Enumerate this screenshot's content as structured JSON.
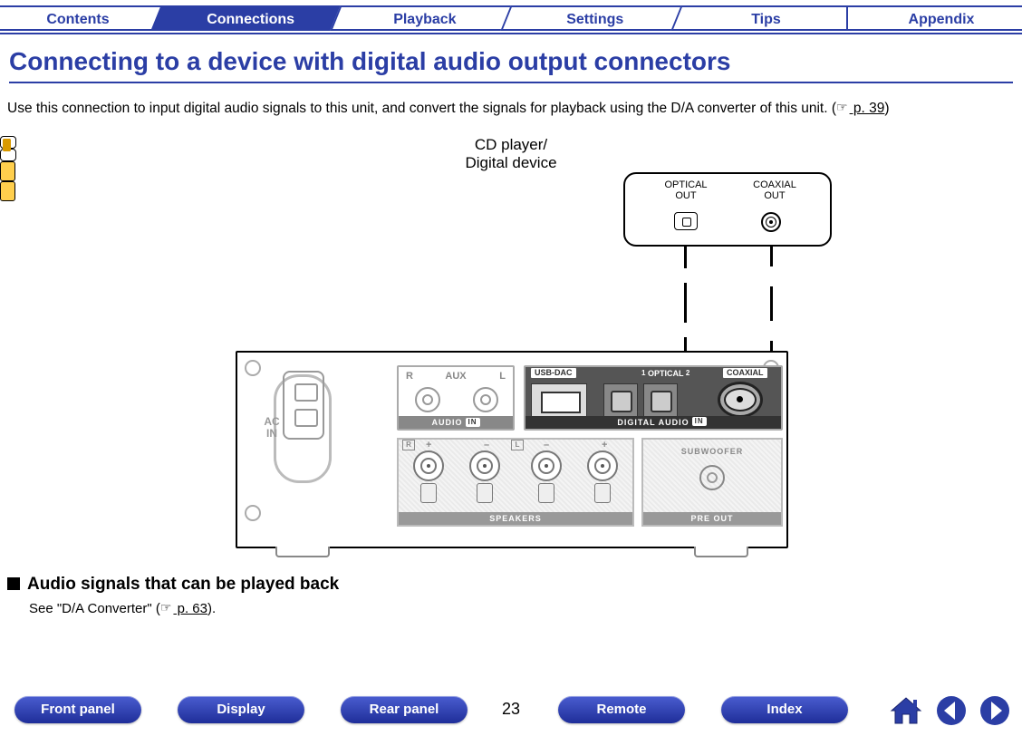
{
  "tabs": {
    "contents": "Contents",
    "connections": "Connections",
    "playback": "Playback",
    "settings": "Settings",
    "tips": "Tips",
    "appendix": "Appendix"
  },
  "title": "Connecting to a device with digital audio output connectors",
  "intro": {
    "text_a": "Use this connection to input digital audio signals to this unit, and convert the signals for playback using the D/A converter of this unit.  (",
    "link": " p. 39",
    "text_b": ")"
  },
  "diagram": {
    "device_label_line1": "CD player/",
    "device_label_line2": "Digital device",
    "optical_out_line1": "OPTICAL",
    "optical_out_line2": "OUT",
    "coaxial_out_line1": "COAXIAL",
    "coaxial_out_line2": "OUT",
    "ac_in": "AC\nIN",
    "aux_r": "R",
    "aux_label": "AUX",
    "aux_l": "L",
    "audio_in": "AUDIO",
    "audio_in_chip": "IN",
    "usb_dac": "USB-DAC",
    "optical_label": "OPTICAL",
    "optical_1": "1",
    "optical_2": "2",
    "coaxial_label": "COAXIAL",
    "digital_audio": "DIGITAL AUDIO",
    "digital_audio_chip": "IN",
    "speakers": "SPEAKERS",
    "spk_r": "R",
    "spk_l": "L",
    "plus": "+",
    "minus": "–",
    "subwoofer": "SUBWOOFER",
    "pre_out": "PRE OUT"
  },
  "subsection": {
    "heading": "Audio signals that can be played back",
    "text_a": "See \"D/A Converter\" (",
    "link": " p. 63",
    "text_b": ")."
  },
  "bottom": {
    "front_panel": "Front panel",
    "display": "Display",
    "rear_panel": "Rear panel",
    "remote": "Remote",
    "index": "Index",
    "page": "23"
  }
}
